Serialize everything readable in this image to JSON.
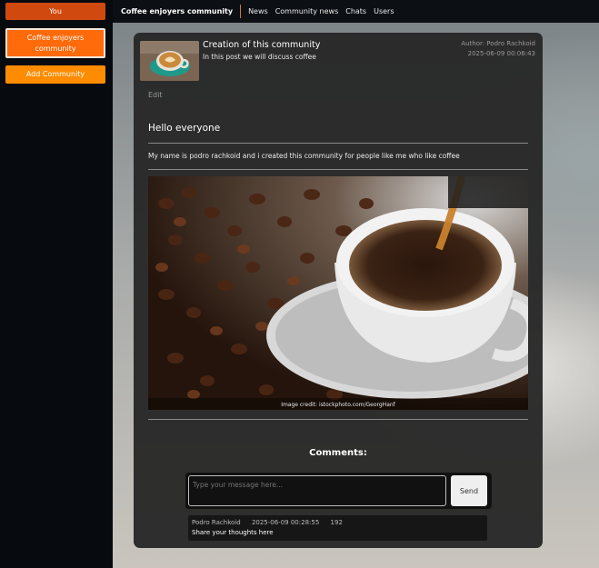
{
  "sidebar": {
    "you_label": "You",
    "community_label": "Coffee enjoyers community",
    "add_label": "Add Community"
  },
  "nav": {
    "title": "Coffee enjoyers community",
    "links": [
      "News",
      "Community news",
      "Chats",
      "Users"
    ]
  },
  "post": {
    "title": "Creation of this community",
    "subtitle": "In this post we will discuss coffee",
    "author": "Author: Podro Rachkoid",
    "date": "2025-06-09 00:06:43",
    "edit_label": "Edit",
    "heading": "Hello everyone",
    "body": "My name is podro rachkoid and i created this community for people like me who like coffee",
    "image_credit": "Image credit: istockphoto.com/GeorgHanf"
  },
  "comments": {
    "heading": "Comments:",
    "input_placeholder": "Type your message here...",
    "send_label": "Send",
    "items": [
      {
        "author": "Podro Rachkoid",
        "date": "2025-06-09 00:28:55",
        "id": "192",
        "text": "Share your thoughts here"
      }
    ]
  },
  "colors": {
    "you": "#d0490e",
    "active": "#ff6a0a",
    "add": "#ff8c00",
    "accent_divider": "#d7791a"
  }
}
